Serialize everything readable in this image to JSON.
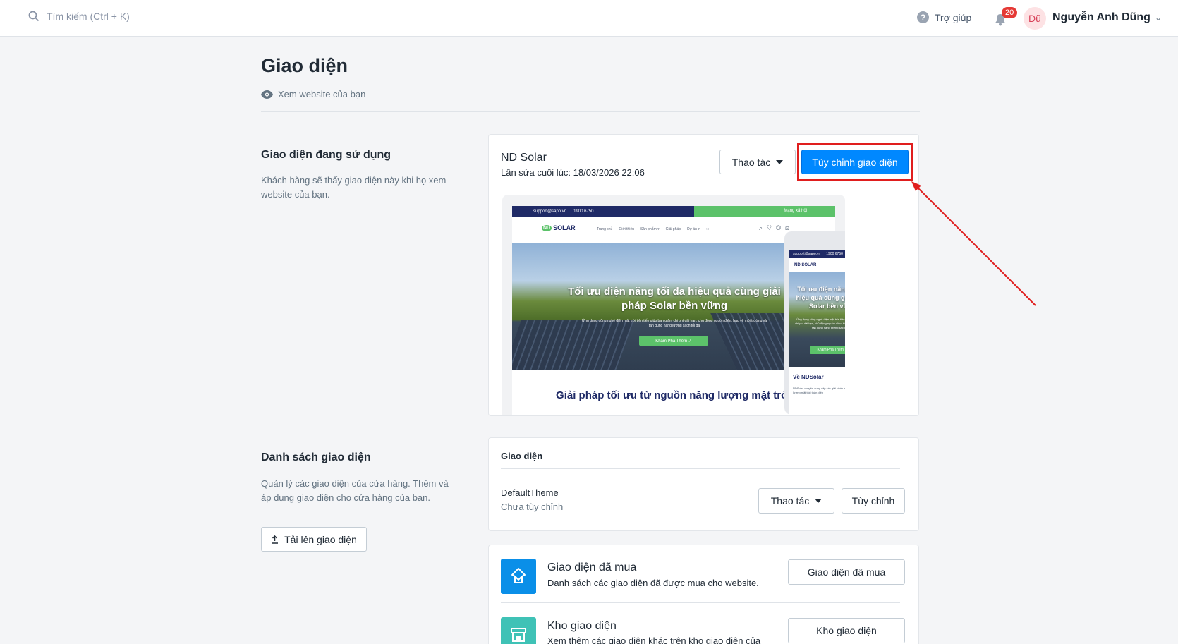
{
  "topbar": {
    "search_placeholder": "Tìm kiếm (Ctrl + K)",
    "help_label": "Trợ giúp",
    "notification_count": "20",
    "avatar_initials": "Dũ",
    "user_name": "Nguyễn Anh Dũng"
  },
  "page": {
    "title": "Giao diện",
    "view_site_label": "Xem website của bạn"
  },
  "current_theme_section": {
    "title": "Giao diện đang sử dụng",
    "description": "Khách hàng sẽ thấy giao diện này khi họ xem website của bạn.",
    "theme_name": "ND Solar",
    "last_edited": "Lần sửa cuối lúc: 18/03/2026 22:06",
    "actions_label": "Thao tác",
    "customize_label": "Tùy chỉnh giao diện"
  },
  "preview": {
    "desktop": {
      "email": "support@sapo.vn",
      "phone": "1900 6750",
      "social_label": "Mạng xã hội",
      "logo": "SOLAR",
      "logo_badge": "ND",
      "menu": [
        "Trang chủ",
        "Giới thiệu",
        "Sản phẩm ▾",
        "Giải pháp",
        "Dự án ▾",
        "‹ ›"
      ],
      "hero_title": "Tối ưu điện năng tối đa hiệu quả cùng giải pháp Solar bền vững",
      "hero_subtitle": "Ứng dụng công nghệ điện mặt trời tiên tiến giúp bạn giảm chi phí dài hạn, chủ động nguồn điện, bảo vệ môi trường và tận dụng năng lượng sạch tối đa",
      "hero_button": "Khám Phá Thêm ↗",
      "section_title": "Giải pháp tối ưu từ nguồn năng lượng mặt trời"
    },
    "mobile": {
      "email": "support@sapo.vn",
      "phone": "1900 6750",
      "logo": "ND SOLAR",
      "hero_title": "Tối ưu điện năng tối đa hiệu quả cùng giải pháp Solar bền vững",
      "hero_subtitle": "Ứng dụng công nghệ điện mặt trời tiên tiến giúp bạn giảm chi phí dài hạn, chủ động nguồn điện, bảo vệ môi trường và tận dụng năng lượng sạch tối đa",
      "hero_button": "Khám Phá Thêm ↗",
      "about_title": "Về NDSolar",
      "about_text": "NDSolar chuyên cung cấp các giải pháp từ nguồn điện năng lượng mặt trời toàn diện"
    }
  },
  "theme_list_section": {
    "title": "Danh sách giao diện",
    "description": "Quản lý các giao diện của cửa hàng. Thêm và áp dụng giao diện cho cửa hàng của bạn.",
    "upload_label": "Tải lên giao diện",
    "card_header": "Giao diện",
    "themes": [
      {
        "name": "DefaultTheme",
        "status": "Chưa tùy chỉnh",
        "actions_label": "Thao tác",
        "customize_label": "Tùy chỉnh"
      }
    ]
  },
  "features": [
    {
      "title": "Giao diện đã mua",
      "description": "Danh sách các giao diện đã được mua cho website.",
      "button": "Giao diện đã mua",
      "color": "#0a8fe8",
      "icon": "purchased-theme-icon"
    },
    {
      "title": "Kho giao diện",
      "description": "Xem thêm các giao diện khác trên kho giao diện của",
      "button": "Kho giao diện",
      "color": "#3fc2b6",
      "icon": "store-icon"
    }
  ],
  "colors": {
    "primary": "#0088ff",
    "highlight": "#e01e1e",
    "background": "#f4f5f7"
  }
}
